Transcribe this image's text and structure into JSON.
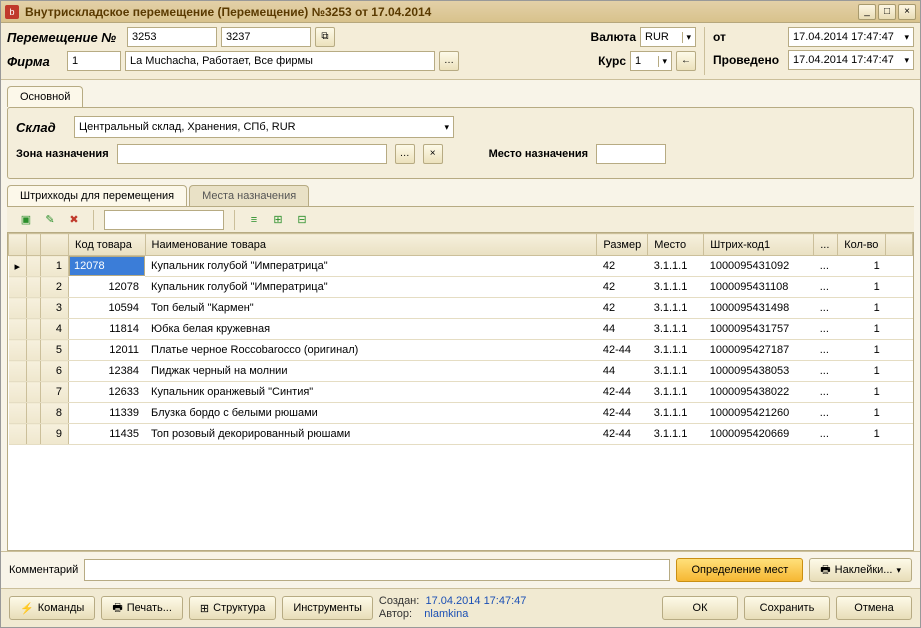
{
  "title": "Внутрискладское перемещение (Перемещение) №3253 от 17.04.2014",
  "header": {
    "move_no_label": "Перемещение №",
    "move_no1": "3253",
    "move_no2": "3237",
    "firm_label": "Фирма",
    "firm_code": "1",
    "firm_name": "La Muchacha, Работает, Все фирмы",
    "currency_label": "Валюта",
    "currency": "RUR",
    "rate_label": "Курс",
    "rate": "1",
    "from_label": "от",
    "conducted_label": "Проведено",
    "date1": "17.04.2014 17:47:47",
    "date2": "17.04.2014 17:47:47"
  },
  "tabs": {
    "main": "Основной"
  },
  "panel": {
    "warehouse_label": "Склад",
    "warehouse": "Центральный склад, Хранения, СПб, RUR",
    "zone_label": "Зона назначения",
    "place_label": "Место назначения"
  },
  "subtabs": {
    "barcodes": "Штрихкоды для перемещения",
    "places": "Места назначения"
  },
  "columns": {
    "code": "Код товара",
    "name": "Наименование товара",
    "size": "Размер",
    "place": "Место",
    "barcode": "Штрих-код1",
    "more": "...",
    "qty": "Кол-во"
  },
  "rows": [
    {
      "n": "1",
      "code": "12078",
      "name": "Купальник голубой \"Императрица\"",
      "size": "42",
      "place": "3.1.1.1",
      "barcode": "1000095431092",
      "more": "...",
      "qty": "1"
    },
    {
      "n": "2",
      "code": "12078",
      "name": "Купальник голубой \"Императрица\"",
      "size": "42",
      "place": "3.1.1.1",
      "barcode": "1000095431108",
      "more": "...",
      "qty": "1"
    },
    {
      "n": "3",
      "code": "10594",
      "name": "Топ белый \"Кармен\"",
      "size": "42",
      "place": "3.1.1.1",
      "barcode": "1000095431498",
      "more": "...",
      "qty": "1"
    },
    {
      "n": "4",
      "code": "11814",
      "name": "Юбка белая кружевная",
      "size": "44",
      "place": "3.1.1.1",
      "barcode": "1000095431757",
      "more": "...",
      "qty": "1"
    },
    {
      "n": "5",
      "code": "12011",
      "name": "Платье черное Roccobarocco (оригинал)",
      "size": "42-44",
      "place": "3.1.1.1",
      "barcode": "1000095427187",
      "more": "...",
      "qty": "1"
    },
    {
      "n": "6",
      "code": "12384",
      "name": "Пиджак черный на молнии",
      "size": "44",
      "place": "3.1.1.1",
      "barcode": "1000095438053",
      "more": "...",
      "qty": "1"
    },
    {
      "n": "7",
      "code": "12633",
      "name": "Купальник оранжевый \"Синтия\"",
      "size": "42-44",
      "place": "3.1.1.1",
      "barcode": "1000095438022",
      "more": "...",
      "qty": "1"
    },
    {
      "n": "8",
      "code": "11339",
      "name": "Блузка бордо с белыми рюшами",
      "size": "42-44",
      "place": "3.1.1.1",
      "barcode": "1000095421260",
      "more": "...",
      "qty": "1"
    },
    {
      "n": "9",
      "code": "11435",
      "name": "Топ розовый декорированный рюшами",
      "size": "42-44",
      "place": "3.1.1.1",
      "barcode": "1000095420669",
      "more": "...",
      "qty": "1"
    }
  ],
  "footer": {
    "comment_label": "Комментарий",
    "define_places": "Определение мест",
    "stickers": "Наклейки...",
    "commands": "Команды",
    "print": "Печать...",
    "structure": "Структура",
    "tools": "Инструменты",
    "created_label": "Создан:",
    "created": "17.04.2014 17:47:47",
    "author_label": "Автор:",
    "author": "nlamkina",
    "ok": "ОК",
    "save": "Сохранить",
    "cancel": "Отмена"
  }
}
